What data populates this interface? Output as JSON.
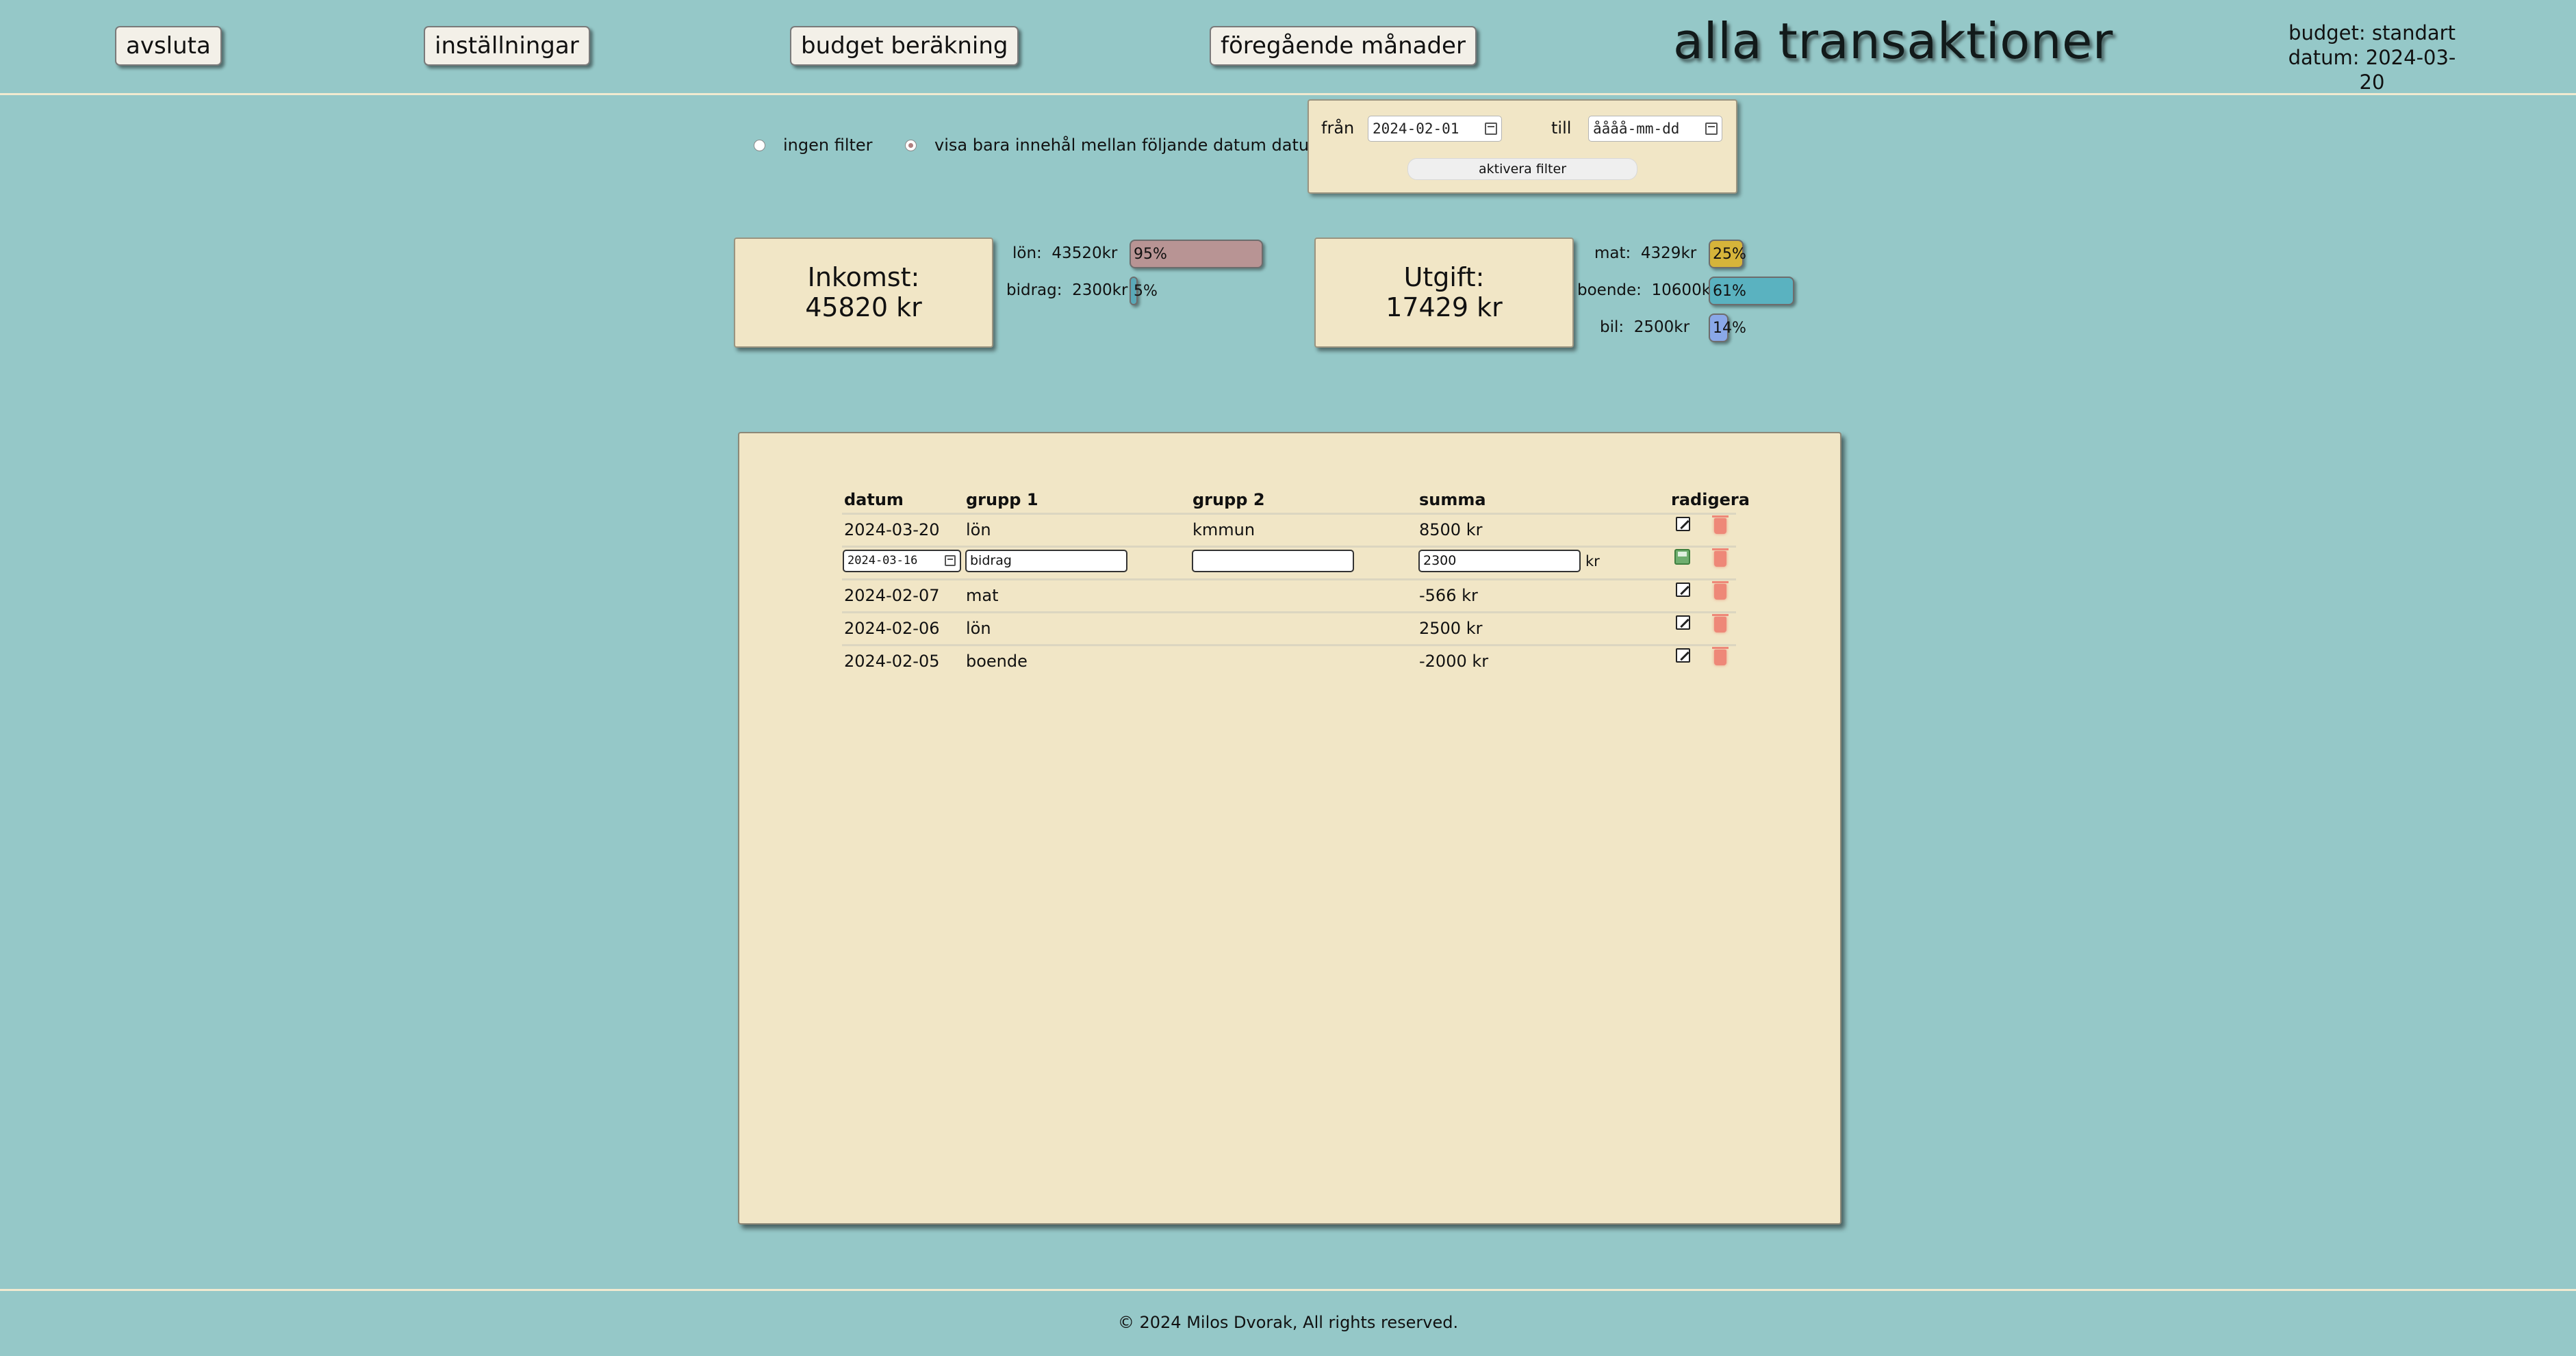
{
  "nav": {
    "quit": "avsluta",
    "settings": "inställningar",
    "budget_calc": "budget beräkning",
    "previous_months": "föregående månader"
  },
  "title": "alla transaktioner",
  "budget_info": {
    "budget": "budget: standart",
    "date": "datum: 2024-03-20"
  },
  "filter": {
    "no_filter": "ingen filter",
    "date_filter": "visa bara innehål mellan följande datum datum",
    "selected": "date_filter",
    "from_label": "från",
    "from_value": "2024-02-01",
    "to_label": "till",
    "to_placeholder": "åååå-mm-dd",
    "activate": "aktivera filter"
  },
  "income": {
    "title": "Inkomst:",
    "total": "45820 kr",
    "items": [
      {
        "label": "lön:",
        "amount": "43520kr",
        "percent_text": "95%",
        "percent": 95,
        "color": "#b89494"
      },
      {
        "label": "bidrag:",
        "amount": "2300kr",
        "percent_text": "5%",
        "percent": 5,
        "color": "#5aa9b8"
      }
    ]
  },
  "expense": {
    "title": "Utgift:",
    "total": "17429 kr",
    "items": [
      {
        "label": "mat:",
        "amount": "4329kr",
        "percent_text": "25%",
        "percent": 25,
        "color": "#d6b43a"
      },
      {
        "label": "boende:",
        "amount": "10600kr",
        "percent_text": "61%",
        "percent": 61,
        "color": "#5ab2c0"
      },
      {
        "label": "bil:",
        "amount": "2500kr",
        "percent_text": "14%",
        "percent": 14,
        "color": "#8aa8e8"
      }
    ]
  },
  "table": {
    "headers": {
      "date": "datum",
      "group1": "grupp 1",
      "group2": "grupp 2",
      "sum": "summa",
      "edit": "radigera"
    },
    "rows": [
      {
        "date": "2024-03-20",
        "group1": "lön",
        "group2": "kmmun",
        "sum": "8500 kr"
      },
      {
        "editing": true,
        "date": "2024-03-16",
        "group1": "bidrag",
        "group2": "",
        "sum": "2300",
        "unit": "kr"
      },
      {
        "date": "2024-02-07",
        "group1": "mat",
        "group2": "",
        "sum": "-566 kr"
      },
      {
        "date": "2024-02-06",
        "group1": "lön",
        "group2": "",
        "sum": "2500 kr"
      },
      {
        "date": "2024-02-05",
        "group1": "boende",
        "group2": "",
        "sum": "-2000 kr"
      }
    ]
  },
  "footer": "© 2024 Milos Dvorak, All rights reserved."
}
